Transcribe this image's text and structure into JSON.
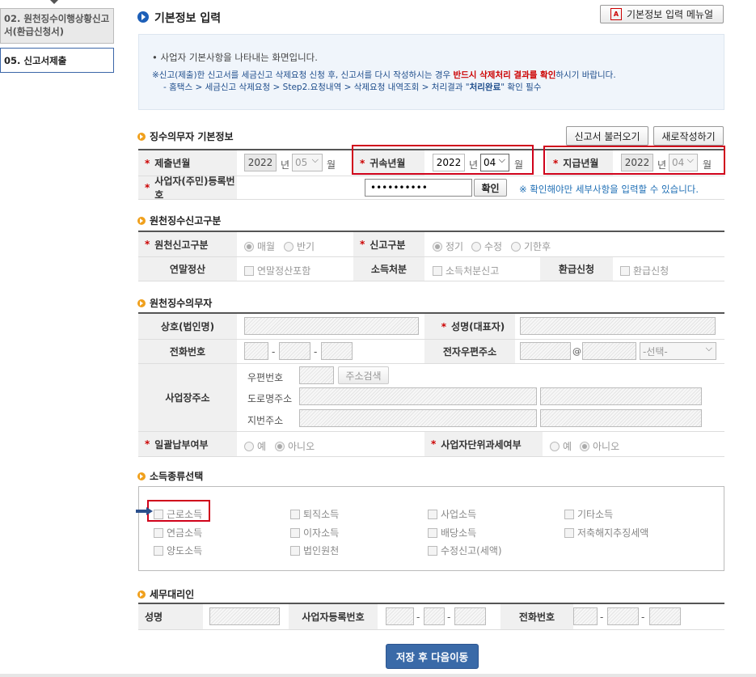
{
  "sidebar": {
    "items": [
      {
        "label": "02. 원천징수이행상황신고서(환급신청서)"
      },
      {
        "label": "05. 신고서제출"
      }
    ]
  },
  "header": {
    "title": "기본정보 입력",
    "manual_button": "기본정보 입력 메뉴얼"
  },
  "notice": {
    "line1": "• 사업자 기본사항을 나타내는 화면입니다.",
    "line2_a": "※신고(제출)한 신고서를 세금신고 삭제요청 신청 후, 신고서를 다시 작성하시는 경우 ",
    "line2_b": "반드시 삭제처리 결과를 확인",
    "line2_c": "하시기 바랍니다.",
    "line3_a": "- 홈택스 > 세금신고 삭제요청 > Step2.요청내역 > 삭제요청 내역조회 > 처리결과 \"",
    "line3_b": "처리완료",
    "line3_c": "\" 확인 필수"
  },
  "section1": {
    "title": "징수의무자 기본정보",
    "load_button": "신고서 불러오기",
    "new_button": "새로작성하기",
    "submit_year_label": "제출년월",
    "submit_year": "2022",
    "submit_month": "05",
    "attr_year_label": "귀속년월",
    "attr_year": "2022",
    "attr_month": "04",
    "pay_year_label": "지급년월",
    "pay_year": "2022",
    "pay_month": "04",
    "year_unit": "년",
    "month_unit": "월",
    "bizno_label": "사업자(주민)등록번호",
    "bizno_value": "••••••••••",
    "confirm_button": "확인",
    "confirm_note": "※ 확인해야만 세부사항을 입력할 수 있습니다."
  },
  "section2": {
    "title": "원천징수신고구분",
    "report_type_label": "원천신고구분",
    "report_type_options": [
      "매월",
      "반기"
    ],
    "report_kind_label": "신고구분",
    "report_kind_options": [
      "정기",
      "수정",
      "기한후"
    ],
    "year_end_label": "연말정산",
    "year_end_option": "연말정산포함",
    "income_disp_label": "소득처분",
    "income_disp_option": "소득처분신고",
    "refund_label": "환급신청",
    "refund_option": "환급신청"
  },
  "section3": {
    "title": "원천징수의무자",
    "company_label": "상호(법인명)",
    "ceo_label": "성명(대표자)",
    "phone_label": "전화번호",
    "email_label": "전자우편주소",
    "email_at": "@",
    "email_select": "-선택-",
    "address_label": "사업장주소",
    "zip_label": "우편번호",
    "zip_button": "주소검색",
    "road_label": "도로명주소",
    "lot_label": "지번주소",
    "lump_label": "일괄납부여부",
    "lump_options": [
      "예",
      "아니오"
    ],
    "unit_label": "사업자단위과세여부",
    "unit_options": [
      "예",
      "아니오"
    ],
    "dash": "-"
  },
  "section4": {
    "title": "소득종류선택",
    "items": [
      "근로소득",
      "퇴직소득",
      "사업소득",
      "기타소득",
      "연금소득",
      "이자소득",
      "배당소득",
      "저축해지추징세액",
      "양도소득",
      "법인원천",
      "수정신고(세액)"
    ]
  },
  "section5": {
    "title": "세무대리인",
    "name_label": "성명",
    "bizno_label": "사업자등록번호",
    "phone_label": "전화번호"
  },
  "footer": {
    "save_button": "저장 후 다음이동"
  },
  "colors": {
    "primary": "#3a6aa8",
    "highlight": "#d0021b",
    "section_dot": "#f0a01c"
  }
}
